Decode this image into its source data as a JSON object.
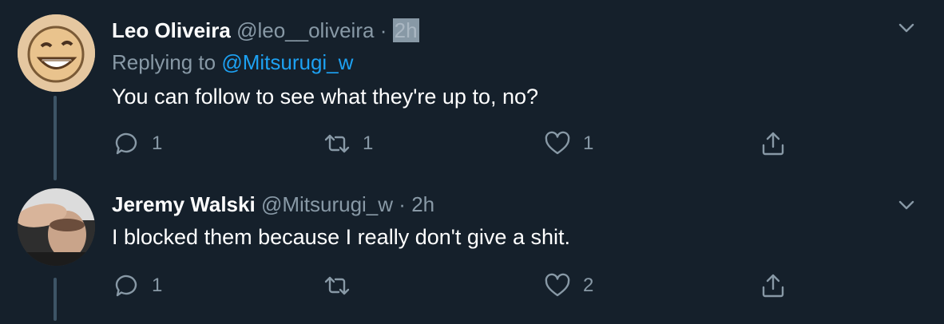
{
  "tweets": [
    {
      "name": "Leo Oliveira",
      "handle": "@leo__oliveira",
      "separator": "·",
      "time": "2h",
      "replying_prefix": "Replying to",
      "replying_to": "@Mitsurugi_w",
      "text": "You can follow to see what they're up to, no?",
      "replies": "1",
      "retweets": "1",
      "likes": "1"
    },
    {
      "name": "Jeremy Walski",
      "handle": "@Mitsurugi_w",
      "separator": "·",
      "time": "2h",
      "text": "I blocked them because I really don't give a shit.",
      "replies": "1",
      "retweets": "",
      "likes": "2"
    }
  ],
  "colors": {
    "background": "#15202b",
    "secondary_text": "#8899a6",
    "link": "#1da1f2",
    "thread_line": "#3d5466"
  },
  "icons": [
    "reply-icon",
    "retweet-icon",
    "like-icon",
    "share-icon",
    "chevron-down-icon"
  ]
}
